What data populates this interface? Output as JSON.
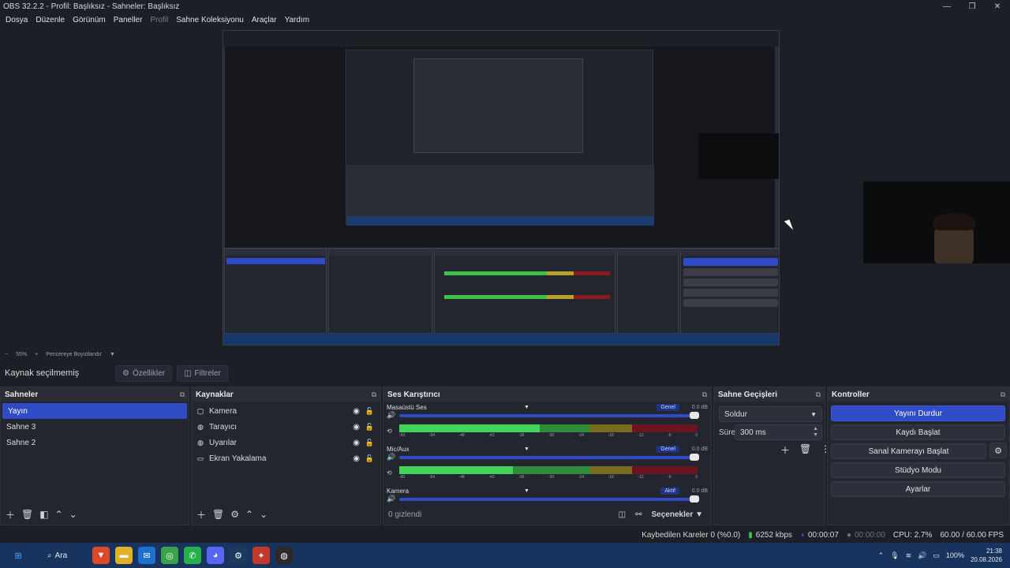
{
  "window": {
    "title": "OBS 32.2.2 - Profil: Başlıksız - Sahneler: Başlıksız"
  },
  "menu": [
    "Dosya",
    "Düzenle",
    "Görünüm",
    "Paneller",
    "Profil",
    "Sahne Koleksiyonu",
    "Araçlar",
    "Yardım"
  ],
  "zoom": {
    "minus": "−",
    "value": "55%",
    "plus": "+",
    "fit_label": "Pencereye Boyutlandır"
  },
  "properties_bar": {
    "no_source": "Kaynak seçilmemiş",
    "properties": "Özellikler",
    "filters": "Filtreler"
  },
  "scenes": {
    "title": "Sahneler",
    "items": [
      "Yayın",
      "Sahne 3",
      "Sahne 2"
    ]
  },
  "sources": {
    "title": "Kaynaklar",
    "items": [
      "Kamera",
      "Tarayıcı",
      "Uyarılar",
      "Ekran Yakalama"
    ]
  },
  "mixer": {
    "title": "Ses Karıştırıcı",
    "channels": [
      {
        "name": "Masaüstü Ses",
        "badge": "Genel",
        "db": "0.0 dB",
        "level": 0.47
      },
      {
        "name": "Mic/Aux",
        "badge": "Genel",
        "db": "0.0 dB",
        "level": 0.38
      },
      {
        "name": "Kamera",
        "badge": "Aktif",
        "db": "0.0 dB",
        "level": 0
      }
    ],
    "ticks": [
      "-60",
      "-54",
      "-48",
      "-42",
      "-36",
      "-30",
      "-24",
      "-18",
      "-12",
      "-6",
      "0"
    ],
    "hidden": "0 gizlendi",
    "options": "Seçenekler"
  },
  "transitions": {
    "title": "Sahne Geçişleri",
    "type": "Soldur",
    "duration_label": "Süre",
    "duration": "300 ms"
  },
  "controls": {
    "title": "Kontroller",
    "stop_stream": "Yayını Durdur",
    "start_record": "Kaydı Başlat",
    "virtual_cam": "Sanal Kamerayı Başlat",
    "studio_mode": "Stüdyo Modu",
    "settings": "Ayarlar"
  },
  "status": {
    "dropped": "Kaybedilen Kareler 0 (%0.0)",
    "bitrate": "6252 kbps",
    "stream_time": "00:00:07",
    "record_time": "00:00:00",
    "cpu": "CPU: 2.7%",
    "fps": "60.00 / 60.00 FPS"
  },
  "taskbar": {
    "search": "Ara",
    "battery": "100%",
    "time": "21:38",
    "date": "20.08.2026"
  },
  "colors": {
    "accent": "#2f4cc6",
    "panel": "#23262e",
    "bg": "#1d1f26",
    "taskbar": "#17335e"
  }
}
